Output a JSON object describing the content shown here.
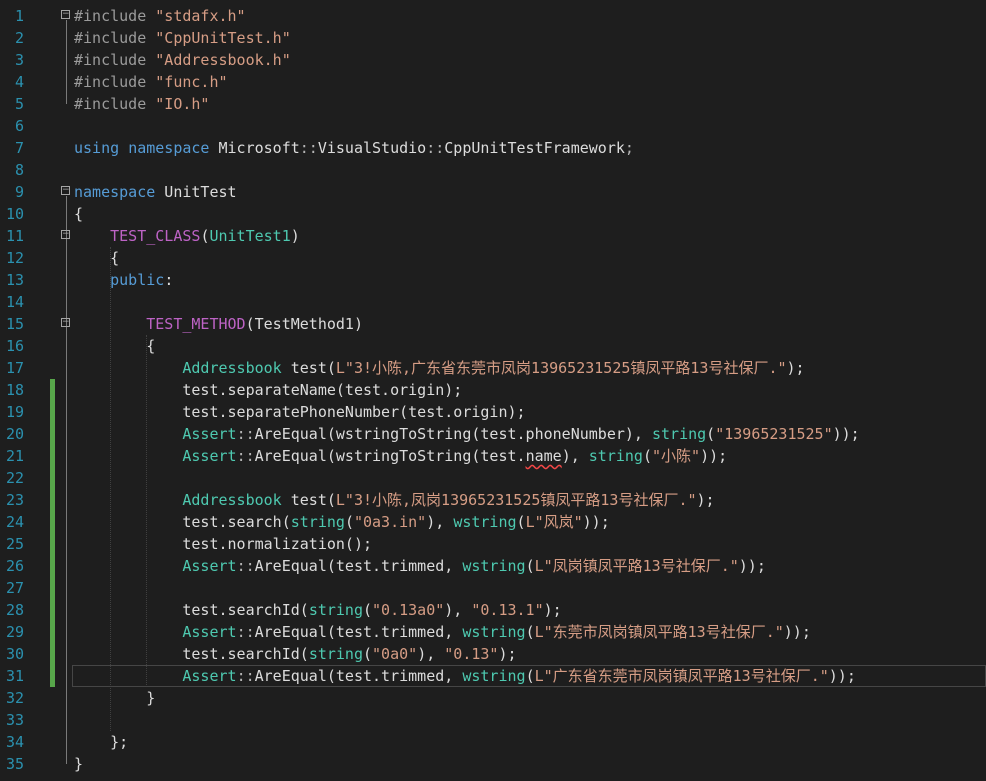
{
  "editor": {
    "lines": [
      {
        "number": "1",
        "fold": "minus",
        "change": false,
        "tokens": [
          {
            "t": "#include ",
            "c": "pre"
          },
          {
            "t": "\"stdafx.h\"",
            "c": "str"
          }
        ]
      },
      {
        "number": "2",
        "fold": "",
        "change": false,
        "tokens": [
          {
            "t": "#include ",
            "c": "pre"
          },
          {
            "t": "\"CppUnitTest.h\"",
            "c": "str"
          }
        ]
      },
      {
        "number": "3",
        "fold": "",
        "change": false,
        "tokens": [
          {
            "t": "#include ",
            "c": "pre"
          },
          {
            "t": "\"Addressbook.h\"",
            "c": "str"
          }
        ]
      },
      {
        "number": "4",
        "fold": "",
        "change": false,
        "tokens": [
          {
            "t": "#include ",
            "c": "pre"
          },
          {
            "t": "\"func.h\"",
            "c": "str"
          }
        ]
      },
      {
        "number": "5",
        "fold": "",
        "change": false,
        "tokens": [
          {
            "t": "#include ",
            "c": "pre"
          },
          {
            "t": "\"IO.h\"",
            "c": "str"
          }
        ]
      },
      {
        "number": "6",
        "fold": "",
        "change": false,
        "tokens": []
      },
      {
        "number": "7",
        "fold": "",
        "change": false,
        "tokens": [
          {
            "t": "using",
            "c": "kw"
          },
          {
            "t": " ",
            "c": "plain"
          },
          {
            "t": "namespace",
            "c": "kw"
          },
          {
            "t": " Microsoft",
            "c": "plain"
          },
          {
            "t": "::",
            "c": "punct"
          },
          {
            "t": "VisualStudio",
            "c": "plain"
          },
          {
            "t": "::",
            "c": "punct"
          },
          {
            "t": "CppUnitTestFramework",
            "c": "plain"
          },
          {
            "t": ";",
            "c": "punct"
          }
        ]
      },
      {
        "number": "8",
        "fold": "",
        "change": false,
        "tokens": []
      },
      {
        "number": "9",
        "fold": "minus",
        "change": false,
        "tokens": [
          {
            "t": "namespace",
            "c": "kw"
          },
          {
            "t": " UnitTest",
            "c": "plain"
          }
        ]
      },
      {
        "number": "10",
        "fold": "",
        "change": false,
        "tokens": [
          {
            "t": "{",
            "c": "plain"
          }
        ]
      },
      {
        "number": "11",
        "fold": "minus",
        "change": false,
        "tokens": [
          {
            "t": "    ",
            "c": "plain"
          },
          {
            "t": "TEST_CLASS",
            "c": "mac"
          },
          {
            "t": "(",
            "c": "plain"
          },
          {
            "t": "UnitTest1",
            "c": "type"
          },
          {
            "t": ")",
            "c": "plain"
          }
        ]
      },
      {
        "number": "12",
        "fold": "",
        "change": false,
        "tokens": [
          {
            "t": "    {",
            "c": "plain"
          }
        ]
      },
      {
        "number": "13",
        "fold": "",
        "change": false,
        "tokens": [
          {
            "t": "    ",
            "c": "plain"
          },
          {
            "t": "public",
            "c": "kw"
          },
          {
            "t": ":",
            "c": "plain"
          }
        ]
      },
      {
        "number": "14",
        "fold": "",
        "change": false,
        "tokens": []
      },
      {
        "number": "15",
        "fold": "minus",
        "change": false,
        "tokens": [
          {
            "t": "        ",
            "c": "plain"
          },
          {
            "t": "TEST_METHOD",
            "c": "mac"
          },
          {
            "t": "(TestMethod1)",
            "c": "plain"
          }
        ]
      },
      {
        "number": "16",
        "fold": "",
        "change": false,
        "tokens": [
          {
            "t": "        {",
            "c": "plain"
          }
        ]
      },
      {
        "number": "17",
        "fold": "",
        "change": false,
        "tokens": [
          {
            "t": "            ",
            "c": "plain"
          },
          {
            "t": "Addressbook",
            "c": "type"
          },
          {
            "t": " test(",
            "c": "plain"
          },
          {
            "t": "L\"3!小陈,广东省东莞市凤岗13965231525镇凤平路13号社保厂.\"",
            "c": "str"
          },
          {
            "t": ");",
            "c": "plain"
          }
        ]
      },
      {
        "number": "18",
        "fold": "",
        "change": true,
        "tokens": [
          {
            "t": "            test.separateName(test.origin);",
            "c": "plain"
          }
        ]
      },
      {
        "number": "19",
        "fold": "",
        "change": true,
        "tokens": [
          {
            "t": "            test.separatePhoneNumber(test.origin);",
            "c": "plain"
          }
        ]
      },
      {
        "number": "20",
        "fold": "",
        "change": true,
        "tokens": [
          {
            "t": "            ",
            "c": "plain"
          },
          {
            "t": "Assert",
            "c": "type"
          },
          {
            "t": "::",
            "c": "punct"
          },
          {
            "t": "AreEqual",
            "c": "plain"
          },
          {
            "t": "(wstringToString(test.phoneNumber), ",
            "c": "plain"
          },
          {
            "t": "string",
            "c": "type"
          },
          {
            "t": "(",
            "c": "plain"
          },
          {
            "t": "\"13965231525\"",
            "c": "str"
          },
          {
            "t": "));",
            "c": "plain"
          }
        ]
      },
      {
        "number": "21",
        "fold": "",
        "change": true,
        "tokens": [
          {
            "t": "            ",
            "c": "plain"
          },
          {
            "t": "Assert",
            "c": "type"
          },
          {
            "t": "::",
            "c": "punct"
          },
          {
            "t": "AreEqual",
            "c": "plain"
          },
          {
            "t": "(wstringToString(test.",
            "c": "plain"
          },
          {
            "t": "name",
            "c": "plain",
            "sq": true
          },
          {
            "t": "), ",
            "c": "plain"
          },
          {
            "t": "string",
            "c": "type"
          },
          {
            "t": "(",
            "c": "plain"
          },
          {
            "t": "\"小陈\"",
            "c": "str"
          },
          {
            "t": "));",
            "c": "plain"
          }
        ]
      },
      {
        "number": "22",
        "fold": "",
        "change": true,
        "tokens": []
      },
      {
        "number": "23",
        "fold": "",
        "change": true,
        "tokens": [
          {
            "t": "            ",
            "c": "plain"
          },
          {
            "t": "Addressbook",
            "c": "type"
          },
          {
            "t": " test(",
            "c": "plain"
          },
          {
            "t": "L\"3!小陈,凤岗13965231525镇凤平路13号社保厂.\"",
            "c": "str"
          },
          {
            "t": ");",
            "c": "plain"
          }
        ]
      },
      {
        "number": "24",
        "fold": "",
        "change": true,
        "tokens": [
          {
            "t": "            test.search(",
            "c": "plain"
          },
          {
            "t": "string",
            "c": "type"
          },
          {
            "t": "(",
            "c": "plain"
          },
          {
            "t": "\"0a3.in\"",
            "c": "str"
          },
          {
            "t": "), ",
            "c": "plain"
          },
          {
            "t": "wstring",
            "c": "type"
          },
          {
            "t": "(",
            "c": "plain"
          },
          {
            "t": "L\"风岚\"",
            "c": "str"
          },
          {
            "t": "));",
            "c": "plain"
          }
        ]
      },
      {
        "number": "25",
        "fold": "",
        "change": true,
        "tokens": [
          {
            "t": "            test.normalization();",
            "c": "plain"
          }
        ]
      },
      {
        "number": "26",
        "fold": "",
        "change": true,
        "tokens": [
          {
            "t": "            ",
            "c": "plain"
          },
          {
            "t": "Assert",
            "c": "type"
          },
          {
            "t": "::",
            "c": "punct"
          },
          {
            "t": "AreEqual",
            "c": "plain"
          },
          {
            "t": "(test.trimmed, ",
            "c": "plain"
          },
          {
            "t": "wstring",
            "c": "type"
          },
          {
            "t": "(",
            "c": "plain"
          },
          {
            "t": "L\"凤岗镇凤平路13号社保厂.\"",
            "c": "str"
          },
          {
            "t": "));",
            "c": "plain"
          }
        ]
      },
      {
        "number": "27",
        "fold": "",
        "change": true,
        "tokens": []
      },
      {
        "number": "28",
        "fold": "",
        "change": true,
        "tokens": [
          {
            "t": "            test.searchId(",
            "c": "plain"
          },
          {
            "t": "string",
            "c": "type"
          },
          {
            "t": "(",
            "c": "plain"
          },
          {
            "t": "\"0.13a0\"",
            "c": "str"
          },
          {
            "t": "), ",
            "c": "plain"
          },
          {
            "t": "\"0.13.1\"",
            "c": "str"
          },
          {
            "t": ");",
            "c": "plain"
          }
        ]
      },
      {
        "number": "29",
        "fold": "",
        "change": true,
        "tokens": [
          {
            "t": "            ",
            "c": "plain"
          },
          {
            "t": "Assert",
            "c": "type"
          },
          {
            "t": "::",
            "c": "punct"
          },
          {
            "t": "AreEqual",
            "c": "plain"
          },
          {
            "t": "(test.trimmed, ",
            "c": "plain"
          },
          {
            "t": "wstring",
            "c": "type"
          },
          {
            "t": "(",
            "c": "plain"
          },
          {
            "t": "L\"东莞市凤岗镇凤平路13号社保厂.\"",
            "c": "str"
          },
          {
            "t": "));",
            "c": "plain"
          }
        ]
      },
      {
        "number": "30",
        "fold": "",
        "change": true,
        "tokens": [
          {
            "t": "            test.searchId(",
            "c": "plain"
          },
          {
            "t": "string",
            "c": "type"
          },
          {
            "t": "(",
            "c": "plain"
          },
          {
            "t": "\"0a0\"",
            "c": "str"
          },
          {
            "t": "), ",
            "c": "plain"
          },
          {
            "t": "\"0.13\"",
            "c": "str"
          },
          {
            "t": ");",
            "c": "plain"
          }
        ]
      },
      {
        "number": "31",
        "fold": "",
        "change": true,
        "current": true,
        "tokens": [
          {
            "t": "            ",
            "c": "plain"
          },
          {
            "t": "Assert",
            "c": "type"
          },
          {
            "t": "::",
            "c": "punct"
          },
          {
            "t": "AreEqual",
            "c": "plain"
          },
          {
            "t": "(test.trimmed, ",
            "c": "plain"
          },
          {
            "t": "wstring",
            "c": "type"
          },
          {
            "t": "(",
            "c": "plain"
          },
          {
            "t": "L\"广东省东莞市凤岗镇凤平路13号社保厂.\"",
            "c": "str"
          },
          {
            "t": "));",
            "c": "plain"
          }
        ]
      },
      {
        "number": "32",
        "fold": "",
        "change": false,
        "tokens": [
          {
            "t": "        }",
            "c": "plain"
          }
        ]
      },
      {
        "number": "33",
        "fold": "",
        "change": false,
        "tokens": []
      },
      {
        "number": "34",
        "fold": "",
        "change": false,
        "tokens": [
          {
            "t": "    };",
            "c": "plain"
          }
        ]
      },
      {
        "number": "35",
        "fold": "",
        "change": false,
        "tokens": [
          {
            "t": "}",
            "c": "plain"
          }
        ]
      }
    ]
  }
}
